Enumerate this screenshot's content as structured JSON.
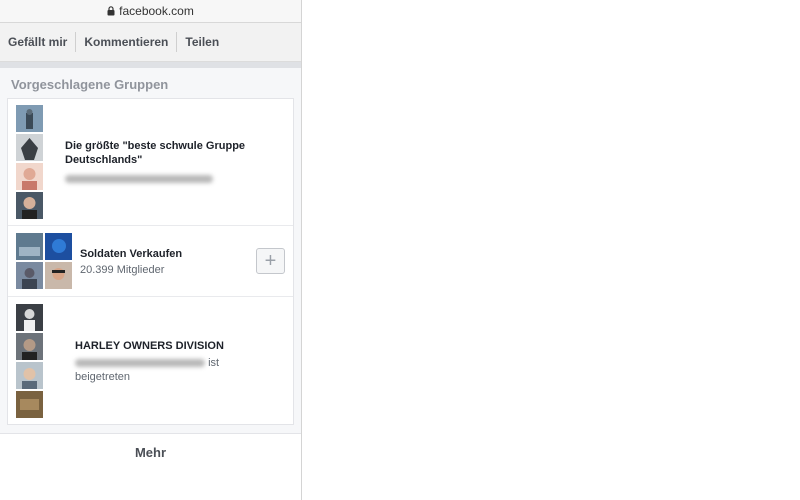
{
  "browser": {
    "url": "facebook.com",
    "lock_icon": "lock-icon"
  },
  "actions": {
    "like": "Gefällt mir",
    "comment": "Kommentieren",
    "share": "Teilen"
  },
  "suggested": {
    "title": "Vorgeschlagene Gruppen",
    "groups": [
      {
        "name": "Die größte \"beste schwule Gruppe Deutschlands\""
      },
      {
        "name": "Soldaten Verkaufen",
        "members": "20.399 Mitglieder",
        "add_icon": "plus-icon"
      },
      {
        "name": "HARLEY OWNERS DIVISION",
        "joined_suffix": "ist",
        "joined_line2": "beigetreten"
      }
    ]
  },
  "more_label": "Mehr",
  "colors": {
    "accent": "#4b4f56",
    "background": "#f6f7f9",
    "muted": "#90949c"
  }
}
